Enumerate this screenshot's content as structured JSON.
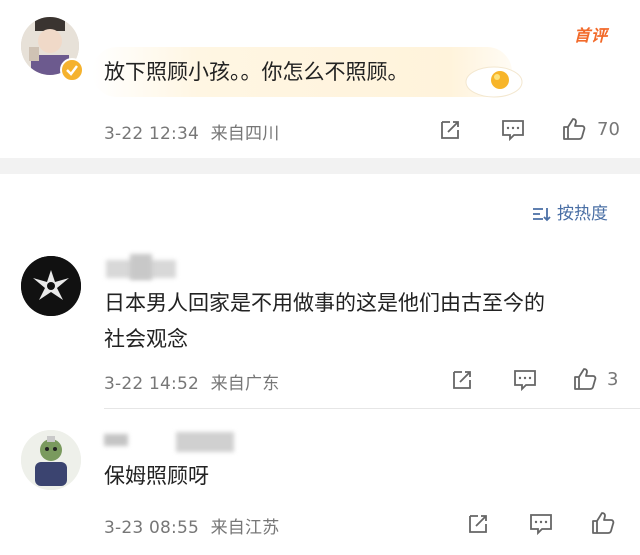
{
  "top_comment": {
    "badge": "首评",
    "text": "放下照顾小孩。。你怎么不照顾。",
    "date": "3-22 12:34",
    "location": "来自四川",
    "like_count": "70"
  },
  "sort": {
    "label": "按热度"
  },
  "comments": [
    {
      "text_line1": "日本男人回家是不用做事的这是他们由古至今的",
      "text_line2": "社会观念",
      "date": "3-22 14:52",
      "location": "来自广东",
      "like_count": "3"
    },
    {
      "text_line1": "保姆照顾呀",
      "date": "3-23 08:55",
      "location": "来自江苏",
      "like_count": ""
    }
  ],
  "colors": {
    "link_blue": "#4a6fa5",
    "meta_gray": "#777777",
    "hot_orange": "#f26a2a",
    "band": "#f2f2f2"
  }
}
